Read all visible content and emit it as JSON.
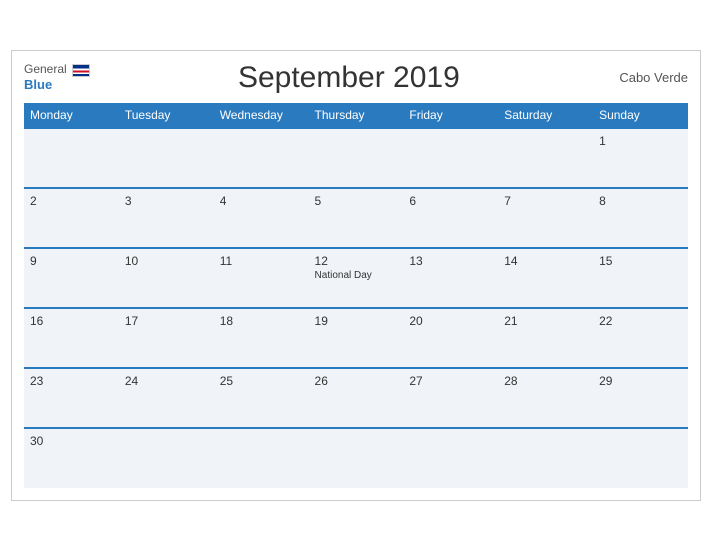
{
  "header": {
    "logo_general": "General",
    "logo_blue": "Blue",
    "title": "September 2019",
    "country": "Cabo Verde"
  },
  "weekdays": [
    "Monday",
    "Tuesday",
    "Wednesday",
    "Thursday",
    "Friday",
    "Saturday",
    "Sunday"
  ],
  "weeks": [
    [
      {
        "day": "",
        "event": ""
      },
      {
        "day": "",
        "event": ""
      },
      {
        "day": "",
        "event": ""
      },
      {
        "day": "",
        "event": ""
      },
      {
        "day": "",
        "event": ""
      },
      {
        "day": "",
        "event": ""
      },
      {
        "day": "1",
        "event": ""
      }
    ],
    [
      {
        "day": "2",
        "event": ""
      },
      {
        "day": "3",
        "event": ""
      },
      {
        "day": "4",
        "event": ""
      },
      {
        "day": "5",
        "event": ""
      },
      {
        "day": "6",
        "event": ""
      },
      {
        "day": "7",
        "event": ""
      },
      {
        "day": "8",
        "event": ""
      }
    ],
    [
      {
        "day": "9",
        "event": ""
      },
      {
        "day": "10",
        "event": ""
      },
      {
        "day": "11",
        "event": ""
      },
      {
        "day": "12",
        "event": "National Day"
      },
      {
        "day": "13",
        "event": ""
      },
      {
        "day": "14",
        "event": ""
      },
      {
        "day": "15",
        "event": ""
      }
    ],
    [
      {
        "day": "16",
        "event": ""
      },
      {
        "day": "17",
        "event": ""
      },
      {
        "day": "18",
        "event": ""
      },
      {
        "day": "19",
        "event": ""
      },
      {
        "day": "20",
        "event": ""
      },
      {
        "day": "21",
        "event": ""
      },
      {
        "day": "22",
        "event": ""
      }
    ],
    [
      {
        "day": "23",
        "event": ""
      },
      {
        "day": "24",
        "event": ""
      },
      {
        "day": "25",
        "event": ""
      },
      {
        "day": "26",
        "event": ""
      },
      {
        "day": "27",
        "event": ""
      },
      {
        "day": "28",
        "event": ""
      },
      {
        "day": "29",
        "event": ""
      }
    ],
    [
      {
        "day": "30",
        "event": ""
      },
      {
        "day": "",
        "event": ""
      },
      {
        "day": "",
        "event": ""
      },
      {
        "day": "",
        "event": ""
      },
      {
        "day": "",
        "event": ""
      },
      {
        "day": "",
        "event": ""
      },
      {
        "day": "",
        "event": ""
      }
    ]
  ],
  "colors": {
    "header_bg": "#2a7abf",
    "row_bg": "#f0f4f8",
    "border": "#2a7abf"
  }
}
